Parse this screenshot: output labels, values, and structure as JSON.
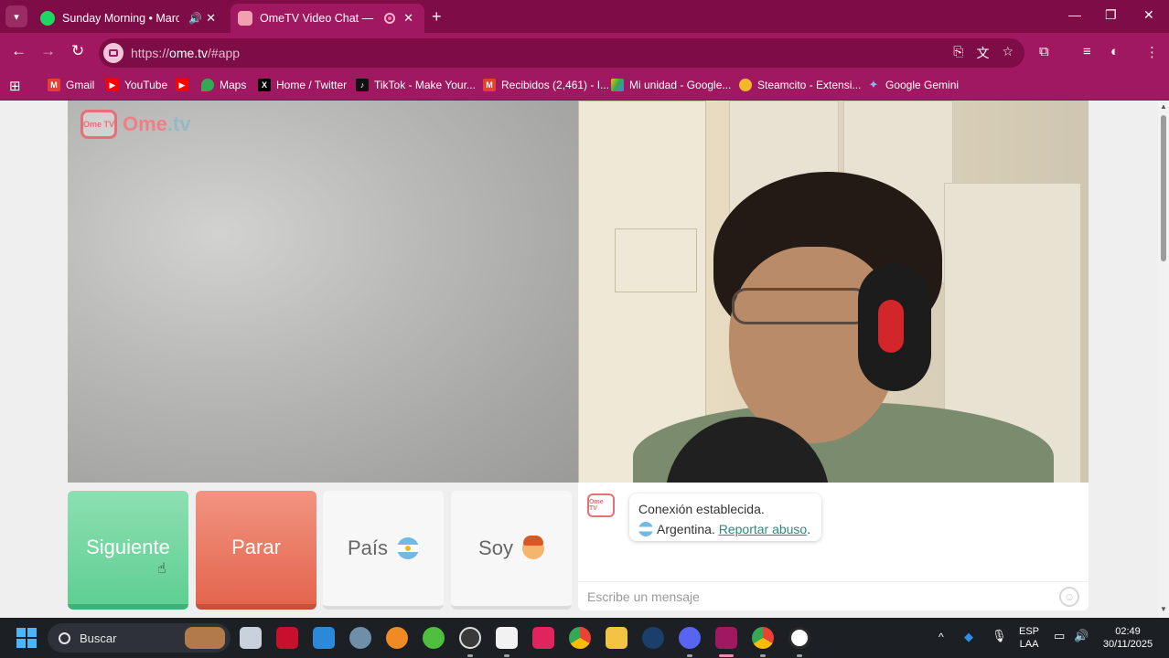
{
  "browser": {
    "tabs": [
      {
        "title": "Sunday Morning • Maroon",
        "active": false
      },
      {
        "title": "OmeTV Video Chat — Ome",
        "active": true
      }
    ],
    "url_prefix": "https://",
    "url_main": "ome.tv",
    "url_rest": "/#app",
    "bookmarks": [
      {
        "label": "Gmail"
      },
      {
        "label": "YouTube"
      },
      {
        "label": ""
      },
      {
        "label": "Maps"
      },
      {
        "label": "Home / Twitter"
      },
      {
        "label": "TikTok - Make Your..."
      },
      {
        "label": "Recibidos (2,461) - I..."
      },
      {
        "label": "Mi unidad - Google..."
      },
      {
        "label": "Steamcito - Extensi..."
      },
      {
        "label": "Google Gemini"
      }
    ]
  },
  "page": {
    "logo_text_main": "Ome",
    "logo_text_tv": ".tv",
    "logo_badge": "Ome TV",
    "buttons": {
      "next": "Siguiente",
      "stop": "Parar",
      "country": "País",
      "gender": "Soy"
    },
    "chat": {
      "avatar_label": "Ome TV",
      "status_line": "Conexión establecida.",
      "country_name": "Argentina.",
      "report_link": "Reportar abuso",
      "report_suffix": ".",
      "input_placeholder": "Escribe un mensaje"
    }
  },
  "taskbar": {
    "search_label": "Buscar",
    "lang_top": "ESP",
    "lang_bottom": "LAA",
    "time": "02:49",
    "date": "30/11/2025"
  },
  "colors": {
    "chrome_frame": "#7d0c47",
    "chrome_toolbar": "#a01860",
    "next_green": "#5fcf93",
    "stop_red": "#e4654e",
    "link_teal": "#2b8a80"
  }
}
